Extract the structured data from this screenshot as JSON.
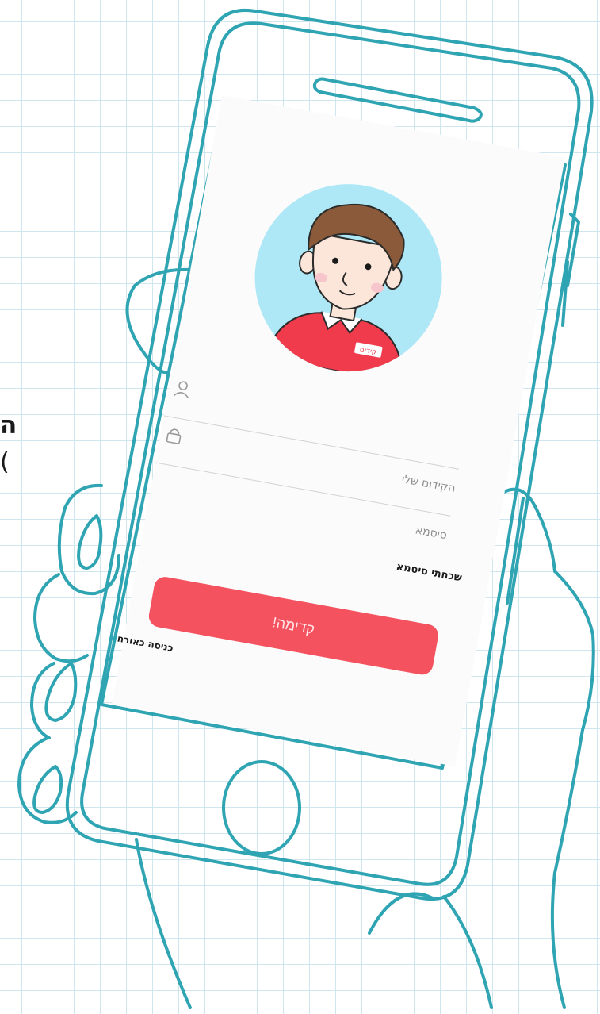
{
  "side": {
    "heading": "ה",
    "sub": "("
  },
  "avatar": {
    "shirt_logo": "קידום"
  },
  "login": {
    "username_label": "הקידום שלי",
    "password_label": "סיסמא",
    "forgot_password": "שכחתי סיסמא",
    "submit_label": "קדימה!",
    "guest_login": "כניסה כאורח"
  },
  "icons": [
    "user-icon",
    "lock-icon"
  ],
  "colors": {
    "accent": "#f4525f",
    "outline": "#2fa4b2",
    "avatar_bg": "#aee8f7",
    "grid": "#cfe6ef"
  }
}
